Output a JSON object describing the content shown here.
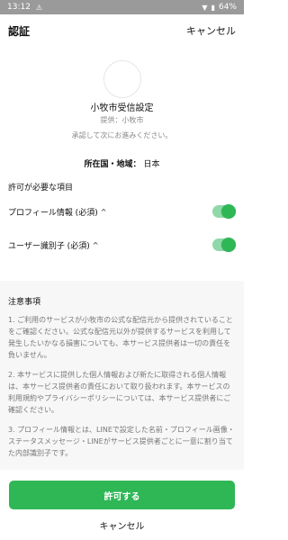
{
  "status_bar": {
    "time": "13:12",
    "battery": "64%"
  },
  "header": {
    "title": "認証",
    "cancel_label": "キャンセル"
  },
  "app": {
    "name": "小牧市受信設定",
    "provider": "提供：小牧市",
    "message": "承認して次にお進みください。"
  },
  "region": {
    "label": "所在国・地域：",
    "value": "日本"
  },
  "permissions": {
    "title": "許可が必要な項目",
    "items": [
      {
        "label": "プロフィール情報 (必須)",
        "enabled": true
      },
      {
        "label": "ユーザー識別子 (必須)",
        "enabled": true
      }
    ]
  },
  "notes": {
    "title": "注意事項",
    "items": [
      "1. ご利用のサービスが小牧市の公式な配信元から提供されていることをご確認ください。公式な配信元以外が提供するサービスを利用して発生したいかなる損害についても、本サービス提供者は一切の責任を負いません。",
      "2. 本サービスに提供した個人情報および新たに取得される個人情報は、本サービス提供者の責任において取り扱われます。本サービスの利用規約やプライバシーポリシーについては、本サービス提供者にご確認ください。",
      "3. プロフィール情報とは、LINEで設定した名前・プロフィール画像・ステータスメッセージ・LINEがサービス提供者ごとに一意に割り当てた内部識別子です。"
    ]
  },
  "actions": {
    "allow_label": "許可する",
    "cancel_label": "キャンセル"
  },
  "colors": {
    "accent": "#2fb756",
    "toggle_track": "#8fd9a8",
    "status_bar": "#9a9a9a"
  }
}
